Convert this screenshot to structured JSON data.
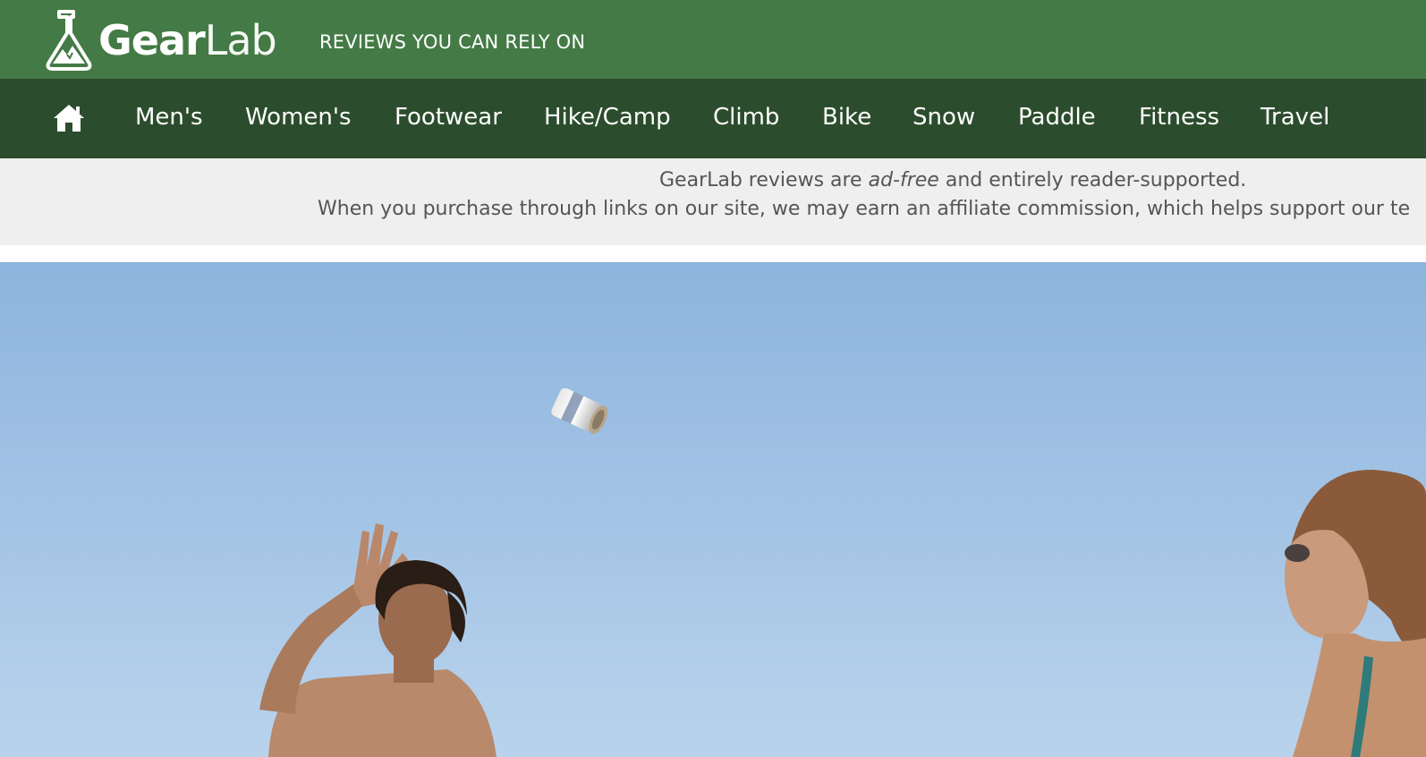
{
  "header": {
    "logo_gear": "Gear",
    "logo_lab": "Lab",
    "tagline": "REVIEWS YOU CAN RELY ON"
  },
  "nav": {
    "home_icon": "home-icon",
    "items": [
      {
        "label": "Men's"
      },
      {
        "label": "Women's"
      },
      {
        "label": "Footwear"
      },
      {
        "label": "Hike/Camp"
      },
      {
        "label": "Climb"
      },
      {
        "label": "Bike"
      },
      {
        "label": "Snow"
      },
      {
        "label": "Paddle"
      },
      {
        "label": "Fitness"
      },
      {
        "label": "Travel"
      }
    ]
  },
  "notice": {
    "line1_before": "GearLab reviews are ",
    "line1_em": "ad-free",
    "line1_after": " and entirely reader-supported.",
    "line2": "When you purchase through links on our site, we may earn an affiliate commission, which helps support our te"
  },
  "colors": {
    "top_bar": "#447a45",
    "nav_bar": "#2c4d2d",
    "notice_bar": "#efefef",
    "sky_top": "#8db4de",
    "sky_bottom": "#b9d3ec"
  }
}
